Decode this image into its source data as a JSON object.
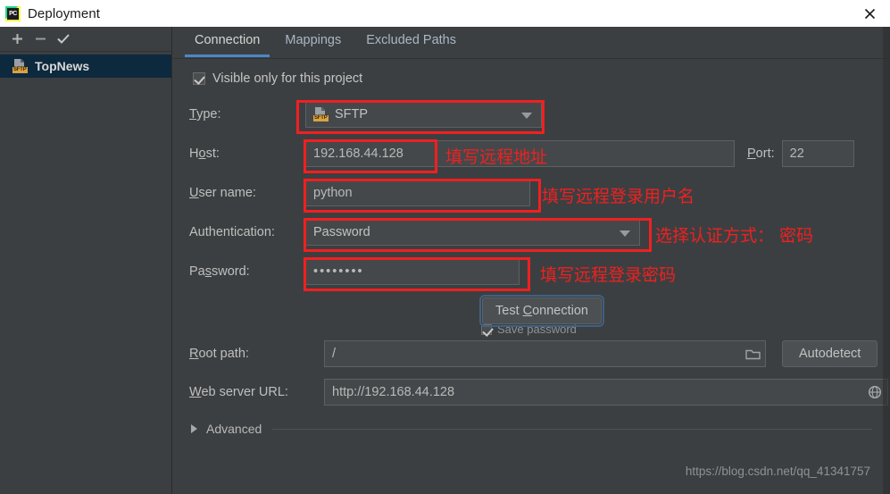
{
  "window": {
    "title": "Deployment",
    "logo_text": "PC",
    "close_label": "×"
  },
  "sidebar": {
    "toolbar": [
      {
        "name": "add",
        "label": "+"
      },
      {
        "name": "remove",
        "label": "−"
      },
      {
        "name": "use-as-default",
        "label": "✓"
      }
    ],
    "servers": [
      {
        "label": "TopNews",
        "type_badge": "SFTP",
        "selected": true
      }
    ]
  },
  "tabs": [
    {
      "label": "Connection",
      "active": true
    },
    {
      "label": "Mappings",
      "active": false
    },
    {
      "label": "Excluded Paths",
      "active": false
    }
  ],
  "form": {
    "visible_only": {
      "label": "Visible only for this project",
      "checked": true
    },
    "type": {
      "label": "Type:",
      "value": "SFTP",
      "badge": "SFTP"
    },
    "host": {
      "label": "Host:",
      "value": "192.168.44.128"
    },
    "port": {
      "label": "Port:",
      "value": "22"
    },
    "username": {
      "label": "User name:",
      "value": "python"
    },
    "authentication": {
      "label": "Authentication:",
      "value": "Password"
    },
    "password": {
      "label": "Password:",
      "value": "••••••••"
    },
    "save_password": {
      "label": "Save password",
      "checked": true
    },
    "test_connection": {
      "label": "Test Connection"
    },
    "root_path": {
      "label": "Root path:",
      "value": "/",
      "browse_icon": "folder-icon"
    },
    "autodetect": {
      "label": "Autodetect"
    },
    "web_server_url": {
      "label": "Web server URL:",
      "value": "http://192.168.44.128",
      "open_icon": "globe-icon"
    },
    "advanced": {
      "label": "Advanced",
      "expanded": false
    }
  },
  "annotations": [
    {
      "name": "host-note",
      "text": "填写远程地址"
    },
    {
      "name": "username-note",
      "text": "填写远程登录用户名"
    },
    {
      "name": "auth-note",
      "text": "选择认证方式： 密码"
    },
    {
      "name": "password-note",
      "text": "填写远程登录密码"
    }
  ],
  "watermark": {
    "text": "https://blog.csdn.net/qq_41341757"
  },
  "colors": {
    "panel_bg": "#3c3f41",
    "field_bg": "#45484a",
    "accent_tab": "#4a88c7",
    "selection": "#0d293e",
    "annotation_red": "#f02020",
    "sftp_badge": "#d9a343"
  }
}
